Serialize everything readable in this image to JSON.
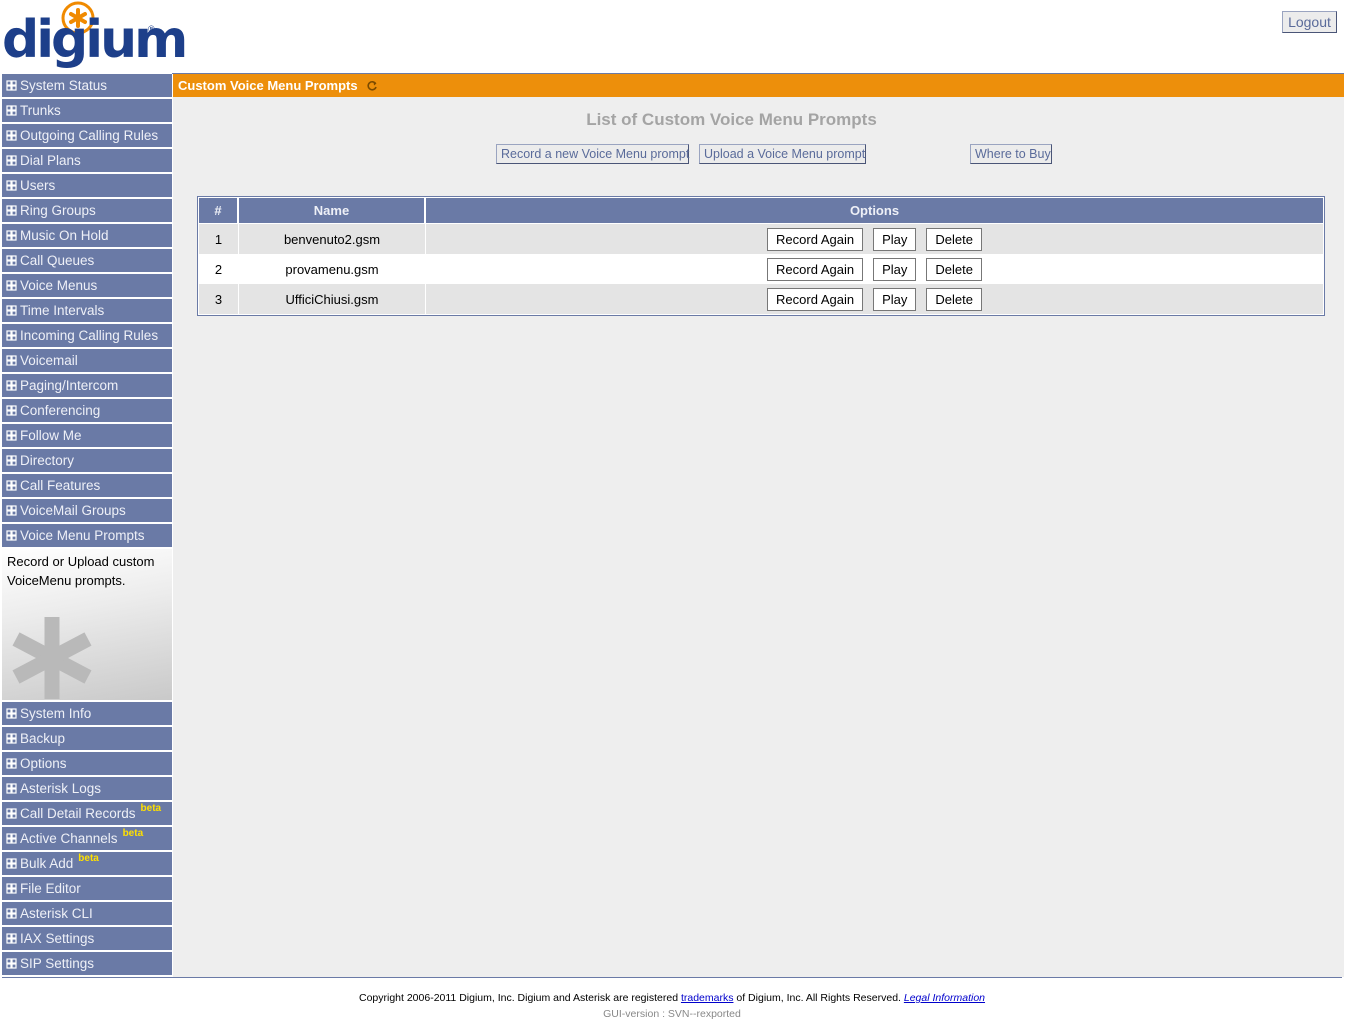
{
  "header": {
    "logo_text": "digium",
    "logo_reg": "®",
    "logout_label": "Logout"
  },
  "sidebar": {
    "items_top": [
      {
        "label": "System Status"
      },
      {
        "label": "Trunks"
      },
      {
        "label": "Outgoing Calling Rules"
      },
      {
        "label": "Dial Plans"
      },
      {
        "label": "Users"
      },
      {
        "label": "Ring Groups"
      },
      {
        "label": "Music On Hold"
      },
      {
        "label": "Call Queues"
      },
      {
        "label": "Voice Menus"
      },
      {
        "label": "Time Intervals"
      },
      {
        "label": "Incoming Calling Rules"
      },
      {
        "label": "Voicemail"
      },
      {
        "label": "Paging/Intercom"
      },
      {
        "label": "Conferencing"
      },
      {
        "label": "Follow Me"
      },
      {
        "label": "Directory"
      },
      {
        "label": "Call Features"
      },
      {
        "label": "VoiceMail Groups"
      },
      {
        "label": "Voice Menu Prompts"
      }
    ],
    "description": "Record or Upload custom VoiceMenu prompts.",
    "items_bottom": [
      {
        "label": "System Info",
        "badge": ""
      },
      {
        "label": "Backup",
        "badge": ""
      },
      {
        "label": "Options",
        "badge": ""
      },
      {
        "label": "Asterisk Logs",
        "badge": ""
      },
      {
        "label": "Call Detail Records",
        "badge": "beta"
      },
      {
        "label": "Active Channels",
        "badge": "beta"
      },
      {
        "label": "Bulk Add",
        "badge": "beta"
      },
      {
        "label": "File Editor",
        "badge": ""
      },
      {
        "label": "Asterisk CLI",
        "badge": ""
      },
      {
        "label": "IAX Settings",
        "badge": ""
      },
      {
        "label": "SIP Settings",
        "badge": ""
      }
    ]
  },
  "main": {
    "title": "Custom Voice Menu Prompts",
    "heading": "List of Custom Voice Menu Prompts",
    "buttons": {
      "record_new": "Record a new Voice Menu prompt",
      "upload": "Upload a Voice Menu prompt",
      "where_to_buy": "Where to Buy"
    },
    "table": {
      "columns": [
        "#",
        "Name",
        "Options"
      ],
      "rows": [
        {
          "num": "1",
          "name": "benvenuto2.gsm"
        },
        {
          "num": "2",
          "name": "provamenu.gsm"
        },
        {
          "num": "3",
          "name": "UfficiChiusi.gsm"
        }
      ],
      "row_actions": {
        "record_again": "Record Again",
        "play": "Play",
        "delete": "Delete"
      }
    }
  },
  "footer": {
    "copyright_pre": "Copyright 2006-2011 Digium, Inc. Digium and Asterisk are registered ",
    "trademarks_link": "trademarks",
    "copyright_mid": " of Digium, Inc. All Rights Reserved. ",
    "legal_link": "Legal Information",
    "gui_version": "GUI-version : SVN--rexported"
  },
  "colors": {
    "nav_bg": "#6a7aa6",
    "title_bar": "#ed8f0b",
    "main_bg": "#eeeeee",
    "logo_blue": "#1d3f8a",
    "logo_orange": "#f08a00",
    "beta": "#ffe000"
  },
  "icons": {
    "nav_bullet": "grid-icon",
    "title_refresh": "refresh-icon",
    "logo_mark": "asterisk-icon"
  }
}
